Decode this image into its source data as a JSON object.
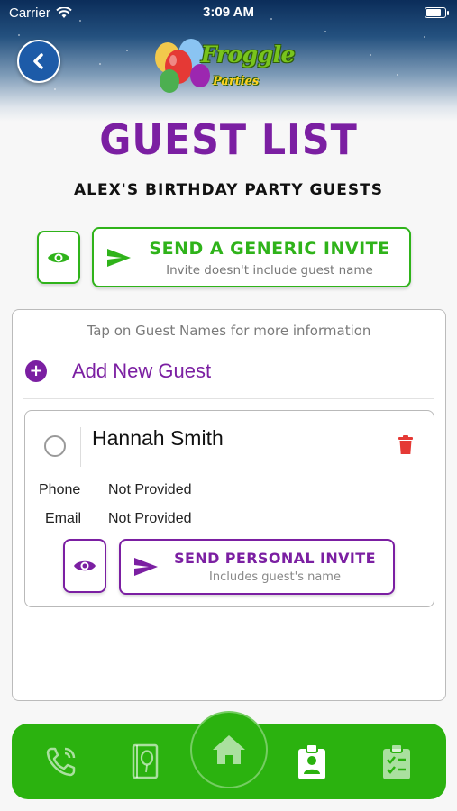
{
  "status_bar": {
    "carrier": "Carrier",
    "time": "3:09 AM",
    "battery_level": 0.9
  },
  "header": {
    "back_icon": "chevron-left-icon",
    "logo": {
      "title": "Froggle",
      "subtitle": "Parties"
    }
  },
  "page": {
    "title": "GUEST LIST",
    "subtitle": "ALEX'S BIRTHDAY PARTY GUESTS"
  },
  "generic_invite": {
    "label": "SEND A GENERIC INVITE",
    "sublabel": "Invite doesn't include guest name",
    "color": "#2fb31a"
  },
  "guest_panel": {
    "hint": "Tap on Guest Names for more information",
    "add_label": "Add New Guest",
    "guests": [
      {
        "name": "Hannah Smith",
        "phone_label": "Phone",
        "phone_value": "Not Provided",
        "email_label": "Email",
        "email_value": "Not Provided",
        "invite_label": "SEND PERSONAL INVITE",
        "invite_sublabel": "Includes guest's name"
      }
    ]
  },
  "bottom_nav": {
    "items": [
      "phone-icon",
      "balloon-card-icon",
      "home-icon",
      "guest-badge-icon",
      "checklist-icon"
    ],
    "active": "guest-badge-icon",
    "color": "#2bb20f"
  },
  "colors": {
    "accent_purple": "#7b1fa2",
    "accent_green": "#2fb31a",
    "delete_red": "#e53935"
  }
}
